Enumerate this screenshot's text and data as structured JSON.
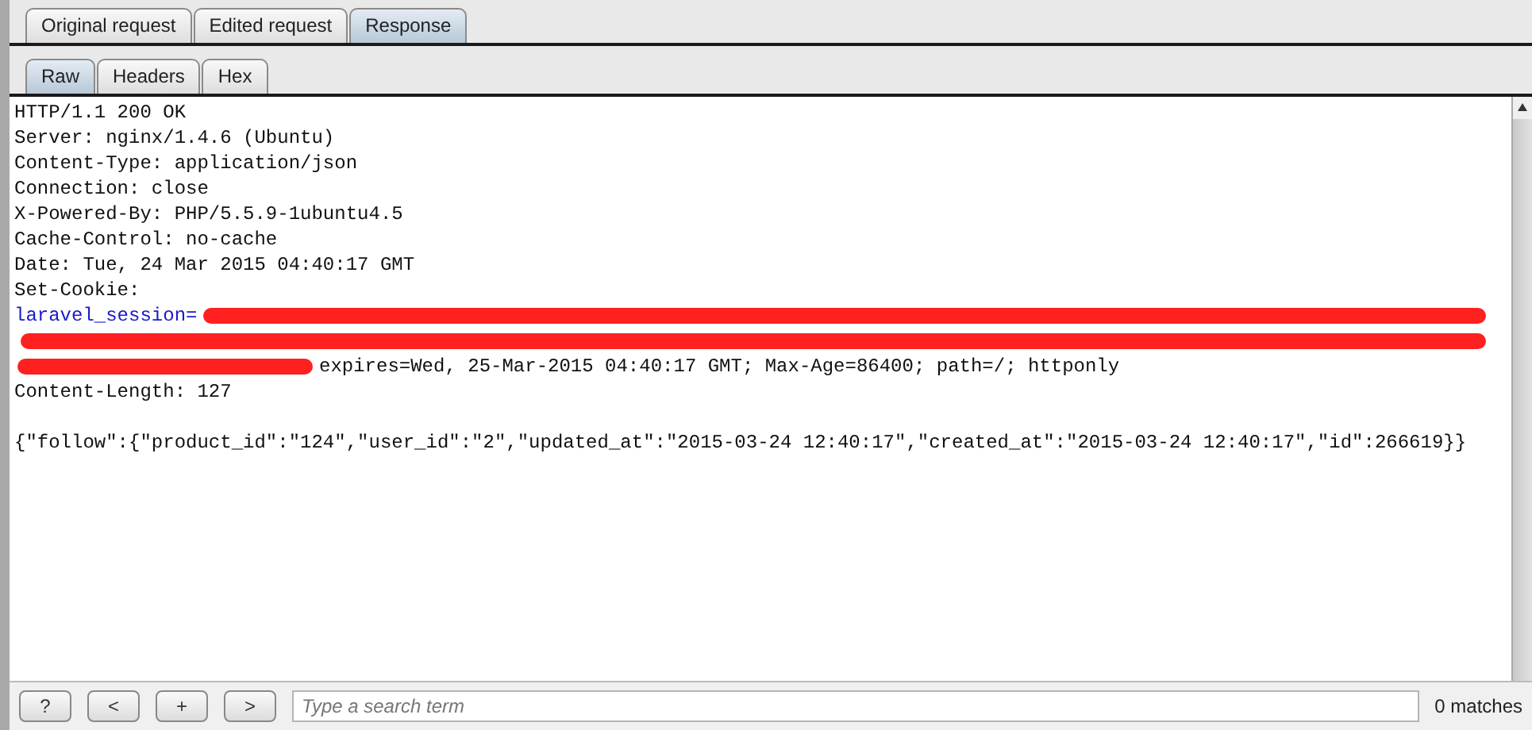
{
  "message_tabs": [
    {
      "label": "Original request",
      "selected": false
    },
    {
      "label": "Edited request",
      "selected": false
    },
    {
      "label": "Response",
      "selected": true
    }
  ],
  "view_tabs": [
    {
      "label": "Raw",
      "selected": true
    },
    {
      "label": "Headers",
      "selected": false
    },
    {
      "label": "Hex",
      "selected": false
    }
  ],
  "response_lines": [
    {
      "segments": [
        {
          "kind": "plain",
          "text": "HTTP/1.1 200 OK"
        }
      ]
    },
    {
      "segments": [
        {
          "kind": "plain",
          "text": "Server: nginx/1.4.6 (Ubuntu)"
        }
      ]
    },
    {
      "segments": [
        {
          "kind": "plain",
          "text": "Content-Type: application/json"
        }
      ]
    },
    {
      "segments": [
        {
          "kind": "plain",
          "text": "Connection: close"
        }
      ]
    },
    {
      "segments": [
        {
          "kind": "plain",
          "text": "X-Powered-By: PHP/5.5.9-1ubuntu4.5"
        }
      ]
    },
    {
      "segments": [
        {
          "kind": "plain",
          "text": "Cache-Control: no-cache"
        }
      ]
    },
    {
      "segments": [
        {
          "kind": "plain",
          "text": "Date: Tue, 24 Mar 2015 04:40:17 GMT"
        }
      ]
    },
    {
      "segments": [
        {
          "kind": "plain",
          "text": "Set-Cookie:"
        }
      ]
    },
    {
      "segments": [
        {
          "kind": "param",
          "text": "laravel_session="
        },
        {
          "kind": "redacted"
        }
      ]
    },
    {
      "segments": [
        {
          "kind": "redacted"
        }
      ]
    },
    {
      "segments": [
        {
          "kind": "redacted"
        },
        {
          "kind": "plain",
          "text": "expires=Wed, 25-Mar-2015 04:40:17 GMT; Max-Age=86400; path=/; httponly"
        }
      ]
    },
    {
      "segments": [
        {
          "kind": "plain",
          "text": "Content-Length: 127"
        }
      ]
    },
    {
      "segments": [
        {
          "kind": "body",
          "text": "{\"follow\":{\"product_id\":\"124\",\"user_id\":\"2\",\"updated_at\":\"2015-03-24 12:40:17\",\"created_at\":\"2015-03-24 12:40:17\",\"id\":266619}}"
        }
      ]
    }
  ],
  "search_bar": {
    "buttons": [
      "?",
      "<",
      "+",
      ">"
    ],
    "placeholder": "Type a search term",
    "matches": "0 matches"
  }
}
